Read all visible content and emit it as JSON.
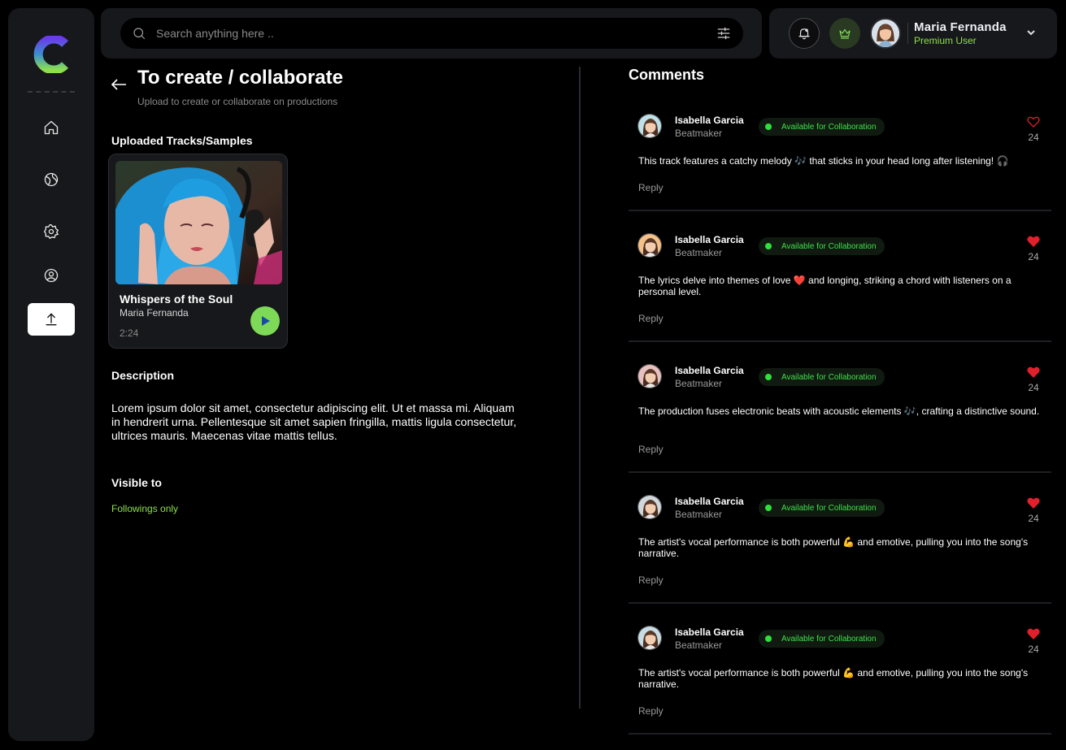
{
  "search": {
    "placeholder": "Search anything here .."
  },
  "user": {
    "name": "Maria Fernanda",
    "role": "Premium User"
  },
  "page": {
    "title": "To create / collaborate",
    "subtitle": "Upload to create or collaborate on productions"
  },
  "tracks_section": {
    "title": "Uploaded Tracks/Samples",
    "track": {
      "title": "Whispers of the Soul",
      "artist": "Maria Fernanda",
      "duration": "2:24"
    }
  },
  "description": {
    "title": "Description",
    "text": "Lorem ipsum dolor sit amet, consectetur adipiscing elit. Ut et massa mi. Aliquam in hendrerit urna. Pellentesque sit amet sapien fringilla, mattis ligula consectetur, ultrices mauris. Maecenas vitae mattis tellus."
  },
  "visibility": {
    "title": "Visible to",
    "value": "Followings only"
  },
  "comments": {
    "title": "Comments",
    "items": [
      {
        "name": "Isabella Garcia",
        "role": "Beatmaker",
        "badge": "Available for Collaboration",
        "text": "This track features a catchy melody 🎶 that sticks in your head long after listening! 🎧",
        "likes": "24",
        "reply": "Reply",
        "liked": false
      },
      {
        "name": "Isabella Garcia",
        "role": "Beatmaker",
        "badge": "Available for Collaboration",
        "text": "The lyrics delve into themes of love ❤️ and longing, striking a chord with listeners on a personal level.",
        "likes": "24",
        "reply": "Reply",
        "liked": true
      },
      {
        "name": "Isabella Garcia",
        "role": "Beatmaker",
        "badge": "Available for Collaboration",
        "text": "The production fuses electronic beats with acoustic elements 🎶, crafting a distinctive sound.",
        "likes": "24",
        "reply": "Reply",
        "liked": true
      },
      {
        "name": "Isabella Garcia",
        "role": "Beatmaker",
        "badge": "Available for Collaboration",
        "text": "The artist's vocal performance is both powerful 💪 and emotive, pulling you into the song's narrative.",
        "likes": "24",
        "reply": "Reply",
        "liked": true
      },
      {
        "name": "Isabella Garcia",
        "role": "Beatmaker",
        "badge": "Available for Collaboration",
        "text": "The artist's vocal performance is both powerful 💪 and emotive, pulling you into the song's narrative.",
        "likes": "24",
        "reply": "Reply",
        "liked": true
      }
    ]
  },
  "colors": {
    "accent": "#7ed957",
    "heart": "#e0202a",
    "badge_text": "#3ee04a",
    "panel": "#17181b"
  },
  "icons": [
    "logo-icon",
    "home-icon",
    "globe-icon",
    "gear-icon",
    "user-circle-icon",
    "upload-icon",
    "search-icon",
    "filter-icon",
    "bell-icon",
    "crown-icon",
    "chevron-down-icon",
    "back-arrow-icon",
    "play-icon",
    "heart-icon"
  ]
}
